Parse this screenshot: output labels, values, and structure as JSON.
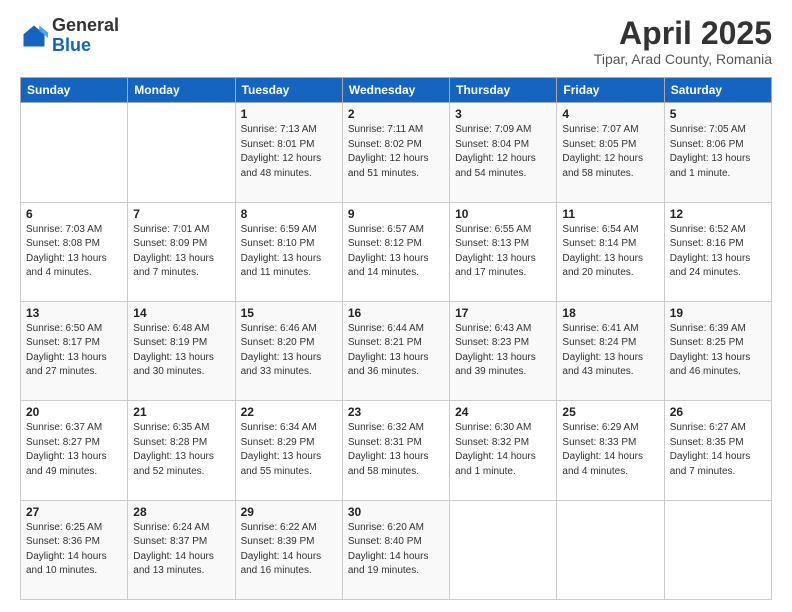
{
  "logo": {
    "general": "General",
    "blue": "Blue"
  },
  "header": {
    "month_year": "April 2025",
    "location": "Tipar, Arad County, Romania"
  },
  "days_of_week": [
    "Sunday",
    "Monday",
    "Tuesday",
    "Wednesday",
    "Thursday",
    "Friday",
    "Saturday"
  ],
  "weeks": [
    [
      {
        "day": "",
        "detail": ""
      },
      {
        "day": "",
        "detail": ""
      },
      {
        "day": "1",
        "detail": "Sunrise: 7:13 AM\nSunset: 8:01 PM\nDaylight: 12 hours and 48 minutes."
      },
      {
        "day": "2",
        "detail": "Sunrise: 7:11 AM\nSunset: 8:02 PM\nDaylight: 12 hours and 51 minutes."
      },
      {
        "day": "3",
        "detail": "Sunrise: 7:09 AM\nSunset: 8:04 PM\nDaylight: 12 hours and 54 minutes."
      },
      {
        "day": "4",
        "detail": "Sunrise: 7:07 AM\nSunset: 8:05 PM\nDaylight: 12 hours and 58 minutes."
      },
      {
        "day": "5",
        "detail": "Sunrise: 7:05 AM\nSunset: 8:06 PM\nDaylight: 13 hours and 1 minute."
      }
    ],
    [
      {
        "day": "6",
        "detail": "Sunrise: 7:03 AM\nSunset: 8:08 PM\nDaylight: 13 hours and 4 minutes."
      },
      {
        "day": "7",
        "detail": "Sunrise: 7:01 AM\nSunset: 8:09 PM\nDaylight: 13 hours and 7 minutes."
      },
      {
        "day": "8",
        "detail": "Sunrise: 6:59 AM\nSunset: 8:10 PM\nDaylight: 13 hours and 11 minutes."
      },
      {
        "day": "9",
        "detail": "Sunrise: 6:57 AM\nSunset: 8:12 PM\nDaylight: 13 hours and 14 minutes."
      },
      {
        "day": "10",
        "detail": "Sunrise: 6:55 AM\nSunset: 8:13 PM\nDaylight: 13 hours and 17 minutes."
      },
      {
        "day": "11",
        "detail": "Sunrise: 6:54 AM\nSunset: 8:14 PM\nDaylight: 13 hours and 20 minutes."
      },
      {
        "day": "12",
        "detail": "Sunrise: 6:52 AM\nSunset: 8:16 PM\nDaylight: 13 hours and 24 minutes."
      }
    ],
    [
      {
        "day": "13",
        "detail": "Sunrise: 6:50 AM\nSunset: 8:17 PM\nDaylight: 13 hours and 27 minutes."
      },
      {
        "day": "14",
        "detail": "Sunrise: 6:48 AM\nSunset: 8:19 PM\nDaylight: 13 hours and 30 minutes."
      },
      {
        "day": "15",
        "detail": "Sunrise: 6:46 AM\nSunset: 8:20 PM\nDaylight: 13 hours and 33 minutes."
      },
      {
        "day": "16",
        "detail": "Sunrise: 6:44 AM\nSunset: 8:21 PM\nDaylight: 13 hours and 36 minutes."
      },
      {
        "day": "17",
        "detail": "Sunrise: 6:43 AM\nSunset: 8:23 PM\nDaylight: 13 hours and 39 minutes."
      },
      {
        "day": "18",
        "detail": "Sunrise: 6:41 AM\nSunset: 8:24 PM\nDaylight: 13 hours and 43 minutes."
      },
      {
        "day": "19",
        "detail": "Sunrise: 6:39 AM\nSunset: 8:25 PM\nDaylight: 13 hours and 46 minutes."
      }
    ],
    [
      {
        "day": "20",
        "detail": "Sunrise: 6:37 AM\nSunset: 8:27 PM\nDaylight: 13 hours and 49 minutes."
      },
      {
        "day": "21",
        "detail": "Sunrise: 6:35 AM\nSunset: 8:28 PM\nDaylight: 13 hours and 52 minutes."
      },
      {
        "day": "22",
        "detail": "Sunrise: 6:34 AM\nSunset: 8:29 PM\nDaylight: 13 hours and 55 minutes."
      },
      {
        "day": "23",
        "detail": "Sunrise: 6:32 AM\nSunset: 8:31 PM\nDaylight: 13 hours and 58 minutes."
      },
      {
        "day": "24",
        "detail": "Sunrise: 6:30 AM\nSunset: 8:32 PM\nDaylight: 14 hours and 1 minute."
      },
      {
        "day": "25",
        "detail": "Sunrise: 6:29 AM\nSunset: 8:33 PM\nDaylight: 14 hours and 4 minutes."
      },
      {
        "day": "26",
        "detail": "Sunrise: 6:27 AM\nSunset: 8:35 PM\nDaylight: 14 hours and 7 minutes."
      }
    ],
    [
      {
        "day": "27",
        "detail": "Sunrise: 6:25 AM\nSunset: 8:36 PM\nDaylight: 14 hours and 10 minutes."
      },
      {
        "day": "28",
        "detail": "Sunrise: 6:24 AM\nSunset: 8:37 PM\nDaylight: 14 hours and 13 minutes."
      },
      {
        "day": "29",
        "detail": "Sunrise: 6:22 AM\nSunset: 8:39 PM\nDaylight: 14 hours and 16 minutes."
      },
      {
        "day": "30",
        "detail": "Sunrise: 6:20 AM\nSunset: 8:40 PM\nDaylight: 14 hours and 19 minutes."
      },
      {
        "day": "",
        "detail": ""
      },
      {
        "day": "",
        "detail": ""
      },
      {
        "day": "",
        "detail": ""
      }
    ]
  ]
}
